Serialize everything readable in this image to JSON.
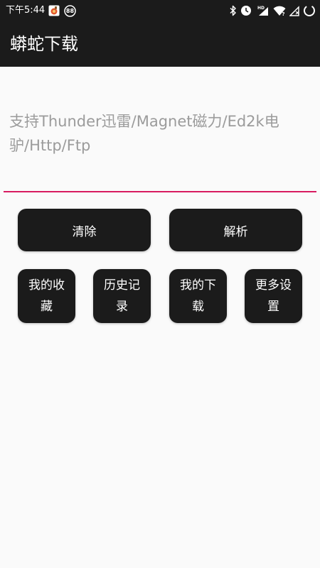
{
  "status_bar": {
    "time": "下午5:44",
    "notification_badge": "88"
  },
  "app_bar": {
    "title": "蟒蛇下载"
  },
  "input": {
    "placeholder": "支持Thunder迅雷/Magnet磁力/Ed2k电驴/Http/Ftp",
    "value": ""
  },
  "actions": {
    "clear_label": "清除",
    "parse_label": "解析"
  },
  "menu": {
    "favorites_label": "我的收藏",
    "history_label": "历史记录",
    "downloads_label": "我的下载",
    "settings_label": "更多设置"
  },
  "colors": {
    "bar_background": "#1b1b1b",
    "page_background": "#fafafa",
    "accent_underline": "#d81b60",
    "button_background": "#1b1b1b",
    "button_text": "#ffffff",
    "placeholder_text": "#9b9b9b"
  },
  "icons": {
    "status_left": [
      "app-notification-icon",
      "badge-icon"
    ],
    "status_right": [
      "bluetooth-icon",
      "alarm-icon",
      "hd-signal-icon",
      "wifi-icon",
      "no-sim-icon",
      "battery-icon"
    ]
  }
}
